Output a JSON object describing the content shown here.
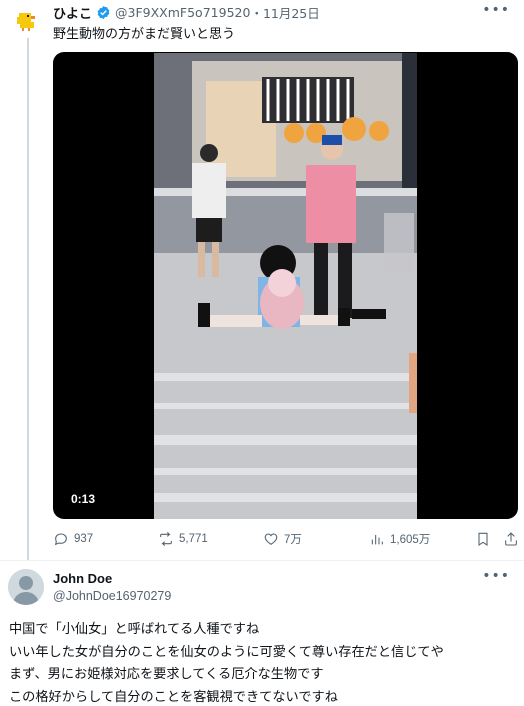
{
  "tweet": {
    "author_name": "ひよこ",
    "handle": "@3F9XXmF5o719520",
    "separator": "・",
    "date": "11月25日",
    "more_icon": "more-icon",
    "text": "野生動物の方がまだ賢いと思う",
    "video": {
      "duration": "0:13"
    },
    "stats": {
      "replies": "937",
      "retweets": "5,771",
      "likes": "7万",
      "views": "1,605万"
    }
  },
  "reply": {
    "author_name": "John Doe",
    "handle": "@JohnDoe16970279",
    "lines": [
      "中国で「小仙女」と呼ばれてる人種ですね",
      "いい年した女が自分のことを仙女のように可愛くて尊い存在だと信じてや",
      "まず、男にお姫様対応を要求してくる厄介な生物です",
      "この格好からして自分のことを客観視できてないですね"
    ]
  },
  "colors": {
    "verified": "#1d9bf0",
    "secondary_text": "#536471",
    "video_bg": "#000000"
  }
}
